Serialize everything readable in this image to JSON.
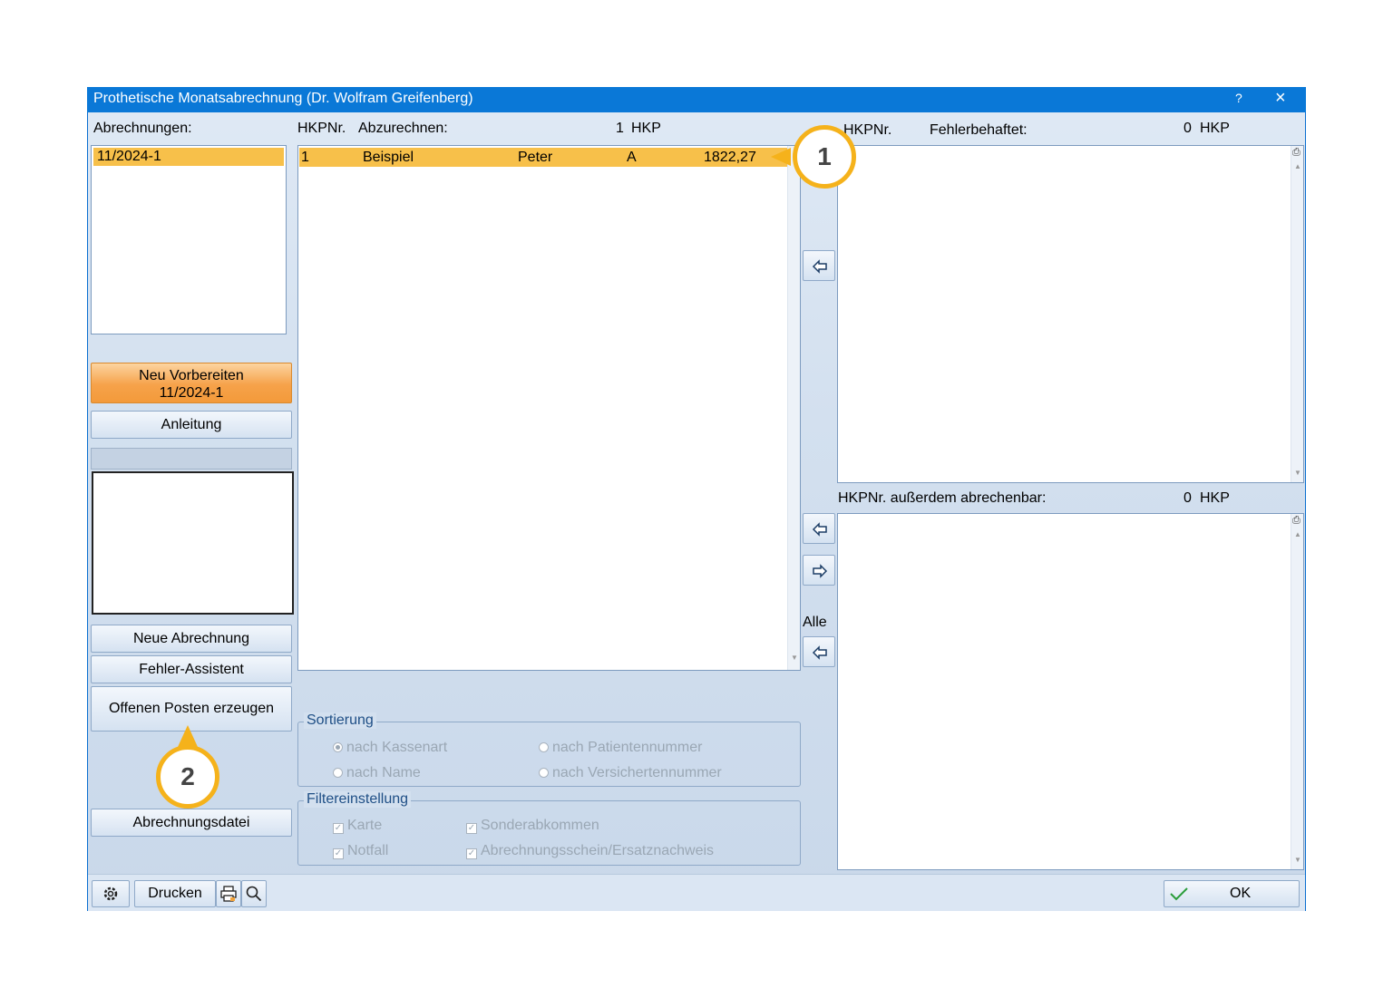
{
  "window": {
    "title": "Prothetische Monatsabrechnung (Dr. Wolfram Greifenberg)",
    "help": "?",
    "close": "×"
  },
  "left": {
    "abrechnungen_label": "Abrechnungen:",
    "abrechnungen": [
      "11/2024-1"
    ],
    "neu_vorbereiten_line1": "Neu Vorbereiten",
    "neu_vorbereiten_line2": "11/2024-1",
    "anleitung": "Anleitung",
    "neue_abrechnung": "Neue Abrechnung",
    "fehler_assistent": "Fehler-Assistent",
    "offenen_posten": "Offenen Posten erzeugen",
    "abrechnungsdatei": "Abrechnungsdatei"
  },
  "middle": {
    "hkpnr_label": "HKPNr.",
    "abzurechnen_label": "Abzurechnen:",
    "count": "1",
    "unit": "HKP",
    "rows": [
      {
        "nr": "1",
        "name": "Beispiel",
        "vorname": "Peter",
        "art": "A",
        "betrag": "1822,27"
      }
    ]
  },
  "arrows": {
    "alle_label": "Alle"
  },
  "right": {
    "hkpnr_label": "HKPNr.",
    "fehlerbehaftet_label": "Fehlerbehaftet:",
    "fehler_count": "0",
    "fehler_unit": "HKP",
    "ausserdem_label": "HKPNr. außerdem abrechenbar:",
    "ausserdem_count": "0",
    "ausserdem_unit": "HKP"
  },
  "sortierung": {
    "legend": "Sortierung",
    "options": [
      "nach Kassenart",
      "nach Patientennummer",
      "nach Name",
      "nach Versichertennummer"
    ],
    "selected": "nach Kassenart"
  },
  "filter": {
    "legend": "Filtereinstellung",
    "options": [
      "Karte",
      "Sonderabkommen",
      "Notfall",
      "Abrechnungsschein/Ersatznachweis"
    ]
  },
  "bottom": {
    "drucken": "Drucken",
    "ok": "OK"
  },
  "callouts": {
    "one": "1",
    "two": "2"
  },
  "colors": {
    "titlebar": "#0a78d7",
    "selection": "#f7c04a",
    "accent_orange": "#f39a3a",
    "callout_ring": "#f5b21b"
  }
}
